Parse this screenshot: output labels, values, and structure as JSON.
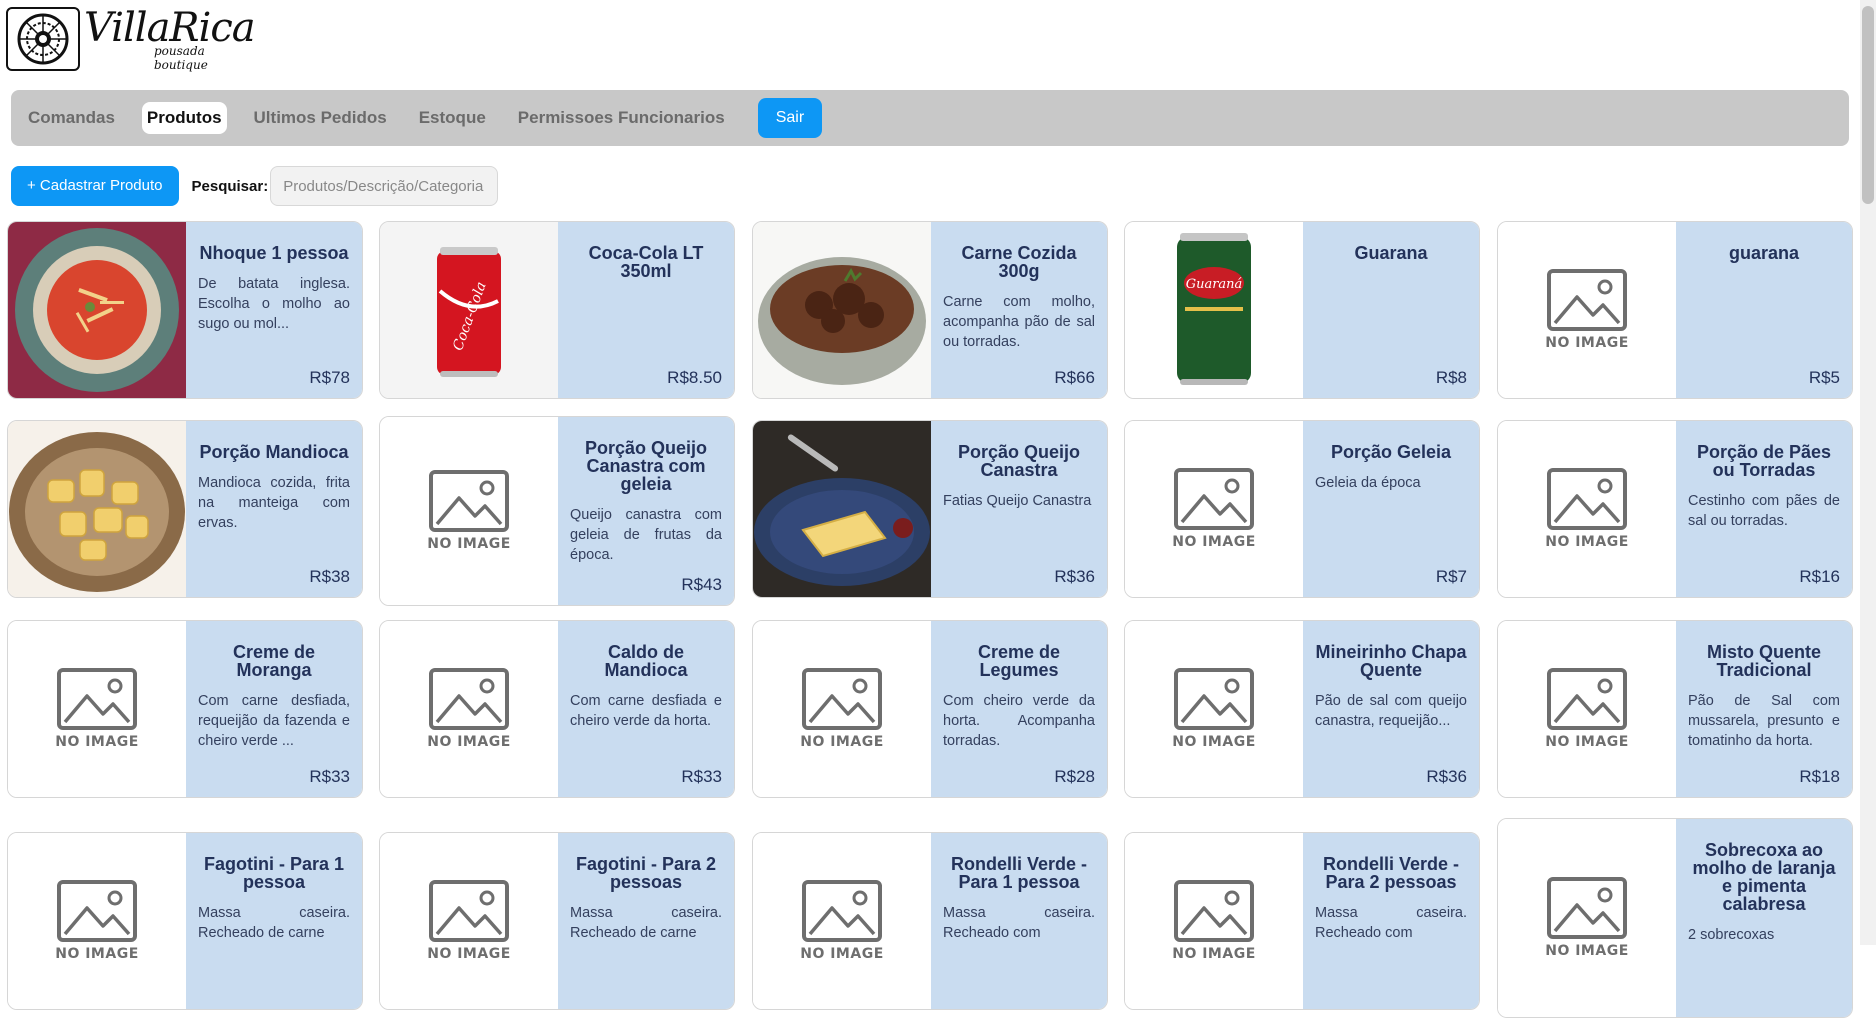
{
  "brand": {
    "name": "VillaRica",
    "tagline": "pousada boutique"
  },
  "nav": {
    "items": [
      "Comandas",
      "Produtos",
      "Ultimos Pedidos",
      "Estoque",
      "Permissoes Funcionarios"
    ],
    "active": "Produtos",
    "logout_label": "Sair"
  },
  "toolbar": {
    "add_label": "+ Cadastrar Produto",
    "search_label": "Pesquisar:",
    "search_placeholder": "Produtos/Descrição/Categoria",
    "search_value": ""
  },
  "no_image_label": "NO IMAGE",
  "products": [
    {
      "name": "Nhoque 1 pessoa",
      "desc": "De batata inglesa. Escolha o molho ao sugo ou mol...",
      "price": "R$78",
      "image": "soup-bowl"
    },
    {
      "name": "Coca-Cola LT 350ml",
      "desc": "",
      "price": "R$8.50",
      "image": "cola-can"
    },
    {
      "name": "Carne Cozida 300g",
      "desc": "Carne com molho, acompanha pão de sal ou torradas.",
      "price": "R$66",
      "image": "beef-bowl"
    },
    {
      "name": "Guarana",
      "desc": "",
      "price": "R$8",
      "image": "guarana-can"
    },
    {
      "name": "guarana",
      "desc": "",
      "price": "R$5",
      "image": "none"
    },
    {
      "name": "Porção Mandioca",
      "desc": "Mandioca cozida, frita na manteiga com ervas.",
      "price": "R$38",
      "image": "cassava-plate"
    },
    {
      "name": "Porção Queijo Canastra com geleia",
      "desc": "Queijo canastra com geleia de frutas da época.",
      "price": "R$43",
      "image": "none"
    },
    {
      "name": "Porção Queijo Canastra",
      "desc": "Fatias Queijo Canastra",
      "price": "R$36",
      "image": "cheese-plate"
    },
    {
      "name": "Porção Geleia",
      "desc": "Geleia da época",
      "price": "R$7",
      "image": "none"
    },
    {
      "name": "Porção de Pães ou Torradas",
      "desc": "Cestinho com pães de sal ou torradas.",
      "price": "R$16",
      "image": "none"
    },
    {
      "name": "Creme de Moranga",
      "desc": "Com carne desfiada, requeijão da fazenda e cheiro verde ...",
      "price": "R$33",
      "image": "none"
    },
    {
      "name": "Caldo de Mandioca",
      "desc": "Com carne desfiada e cheiro verde da horta.",
      "price": "R$33",
      "image": "none"
    },
    {
      "name": "Creme de Legumes",
      "desc": "Com cheiro verde da horta. Acompanha torradas.",
      "price": "R$28",
      "image": "none"
    },
    {
      "name": "Mineirinho Chapa Quente",
      "desc": "Pão de sal com queijo canastra, requeijão...",
      "price": "R$36",
      "image": "none"
    },
    {
      "name": "Misto Quente Tradicional",
      "desc": "Pão de Sal com mussarela, presunto e tomatinho da horta.",
      "price": "R$18",
      "image": "none"
    },
    {
      "name": "Fagotini - Para 1 pessoa",
      "desc": "Massa caseira. Recheado de carne",
      "price": "",
      "image": "none"
    },
    {
      "name": "Fagotini - Para 2 pessoas",
      "desc": "Massa caseira. Recheado de carne",
      "price": "",
      "image": "none"
    },
    {
      "name": "Rondelli Verde - Para 1 pessoa",
      "desc": "Massa caseira. Recheado com",
      "price": "",
      "image": "none"
    },
    {
      "name": "Rondelli Verde - Para 2 pessoas",
      "desc": "Massa caseira. Recheado com",
      "price": "",
      "image": "none"
    },
    {
      "name": "Sobrecoxa ao molho de laranja e pimenta calabresa",
      "desc": "2 sobrecoxas",
      "price": "",
      "image": "none"
    }
  ]
}
